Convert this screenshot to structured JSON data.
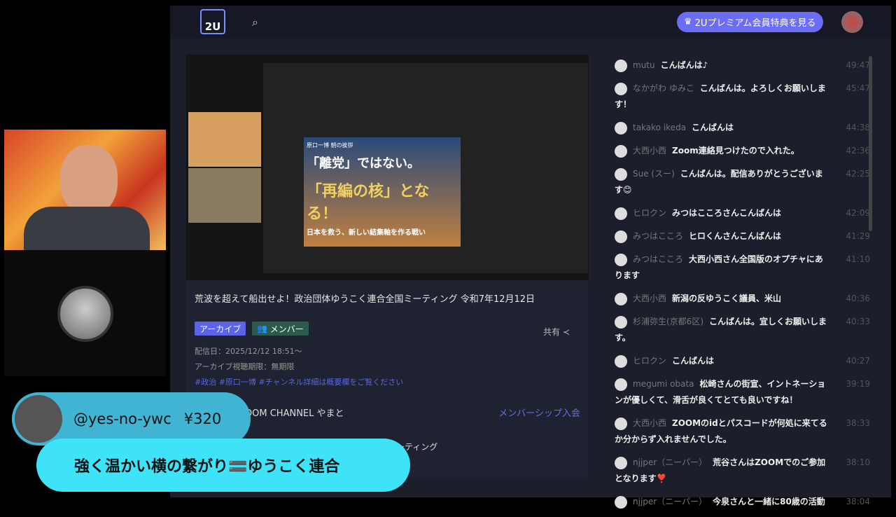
{
  "header": {
    "logo": "2U",
    "premium_label": "2Uプレミアム会員特典を見る"
  },
  "video": {
    "slide_caption": "原口一博 朝の挨拶",
    "slide_line1": "「離党」ではない。",
    "slide_line2": "「再編の核」となる！",
    "slide_line3": "日本を救う、新しい結集軸を作る戦い"
  },
  "info": {
    "title": "荒波を超えて船出せよ！政治団体ゆうこく連合全国ミーティング 令和7年12月12日",
    "badge_archive": "アーカイブ",
    "badge_member": "メンバー",
    "share": "共有",
    "date": "配信日：2025/12/12 18:51〜",
    "limit": "アーカイブ視聴期限：無期限",
    "tags": "#政治  #原口一博  #チャンネル詳細は概要欄をご覧ください",
    "channel": "博 THE WISDOM CHANNEL やまと",
    "join": "メンバーシップ入会",
    "meeting": "ーティング"
  },
  "chat": [
    {
      "name": "mutu",
      "text": "こんばんは♪",
      "time": "49:47"
    },
    {
      "name": "なかがわ ゆみこ",
      "text": "こんばんは。よろしくお願いします！",
      "time": "45:47"
    },
    {
      "name": "takako ikeda",
      "text": "こんばんは",
      "time": "44:38"
    },
    {
      "name": "大西小西",
      "text": "Zoom連絡見つけたので入れた。",
      "time": "42:36"
    },
    {
      "name": "Sue (スー)",
      "text": "こんばんは。配信ありがとうございます😊",
      "time": "42:25"
    },
    {
      "name": "ヒロクン",
      "text": "みつはこころさんこんばんは",
      "time": "42:09"
    },
    {
      "name": "みつはこころ",
      "text": "ヒロくんさんこんばんは",
      "time": "41:29"
    },
    {
      "name": "みつはこころ",
      "text": "大西小西さん全国版のオプチャにあります",
      "time": "41:10"
    },
    {
      "name": "大西小西",
      "text": "新潟の反ゆうこく議員、米山",
      "time": "40:36"
    },
    {
      "name": "杉浦弥生(京都6区)",
      "text": "こんばんは。宜しくお願いします。",
      "time": "40:33"
    },
    {
      "name": "ヒロクン",
      "text": "こんばんは",
      "time": "40:27"
    },
    {
      "name": "megumi obata",
      "text": "松崎さんの街宣、イントネーションが優しくて、滑舌が良くてとても良いですね！",
      "time": "39:19"
    },
    {
      "name": "大西小西",
      "text": "ZOOMのidとパスコードが何処に来てるか分からず入れませんでした。",
      "time": "38:33"
    },
    {
      "name": "njjper（ニーパー）",
      "text": "荒谷さんはZOOMでのご参加となります❣️",
      "time": "38:10"
    },
    {
      "name": "njjper（ニーパー）",
      "text": "今泉さんと一緒に80歳の活動",
      "time": "38:04"
    }
  ],
  "superchat": {
    "user": "@yes-no-ywc",
    "amount": "¥320",
    "message": "強く温かい横の繋がり🟰ゆうこく連合"
  }
}
